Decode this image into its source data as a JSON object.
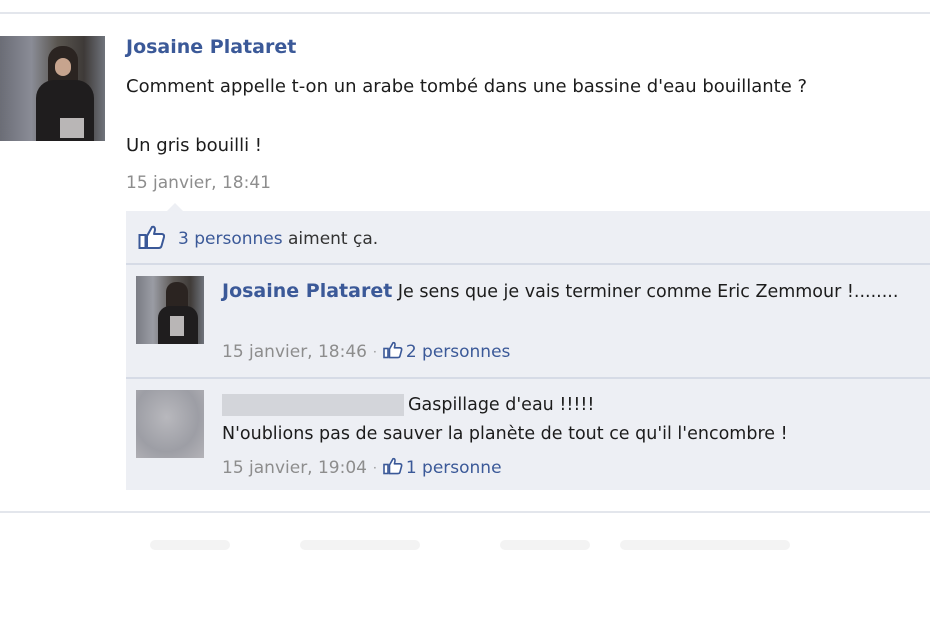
{
  "post": {
    "author": "Josaine Plataret",
    "text_line1": "Comment appelle t-on un arabe tombé dans une bassine d'eau bouillante ?",
    "text_line2": "Un gris bouilli !",
    "timestamp": "15 janvier, 18:41"
  },
  "likes": {
    "count_text": "3 personnes",
    "suffix": " aiment ça."
  },
  "comments": [
    {
      "author": "Josaine Plataret",
      "text": "Je sens que je vais terminer comme Eric Zemmour !........",
      "timestamp": "15 janvier, 18:46",
      "likes": "2 personnes"
    },
    {
      "author": "",
      "text_line1": "Gaspillage d'eau !!!!!",
      "text_line2": "N'oublions pas de sauver la planète de tout ce qu'il l'encombre !",
      "timestamp": "15 janvier, 19:04",
      "likes": "1 personne"
    }
  ],
  "meta": {
    "separator": "·"
  },
  "colors": {
    "link": "#3b5998",
    "meta": "#8d8d8d",
    "box": "#edeff4"
  },
  "icons": {
    "like": "thumbs-up-icon"
  }
}
